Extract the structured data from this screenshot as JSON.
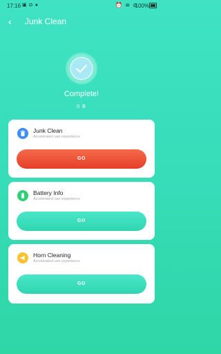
{
  "status_bar": {
    "time": "17:16",
    "battery": "100%",
    "notification_icons": "▣ ◘ ●",
    "system_icons": "⏰ ≋ ⊘"
  },
  "header": {
    "title": "Junk Clean",
    "back_icon": "‹"
  },
  "result": {
    "status": "Complete!",
    "cleaned_size": "0 B"
  },
  "cards": [
    {
      "title": "Junk Clean",
      "subtitle": "Accelerated use experience",
      "button": "GO",
      "icon": "trash-icon",
      "icon_color": "#3a8ef6",
      "button_color": "#f25a3e"
    },
    {
      "title": "Battery Info",
      "subtitle": "Accelerated use experience",
      "button": "GO",
      "icon": "battery-icon",
      "icon_color": "#2fd176",
      "button_color": "#3fe0c0"
    },
    {
      "title": "Horn Cleaning",
      "subtitle": "Accelerated use experience",
      "button": "GO",
      "icon": "horn-icon",
      "icon_color": "#f8c230",
      "button_color": "#3fe0c0"
    }
  ]
}
